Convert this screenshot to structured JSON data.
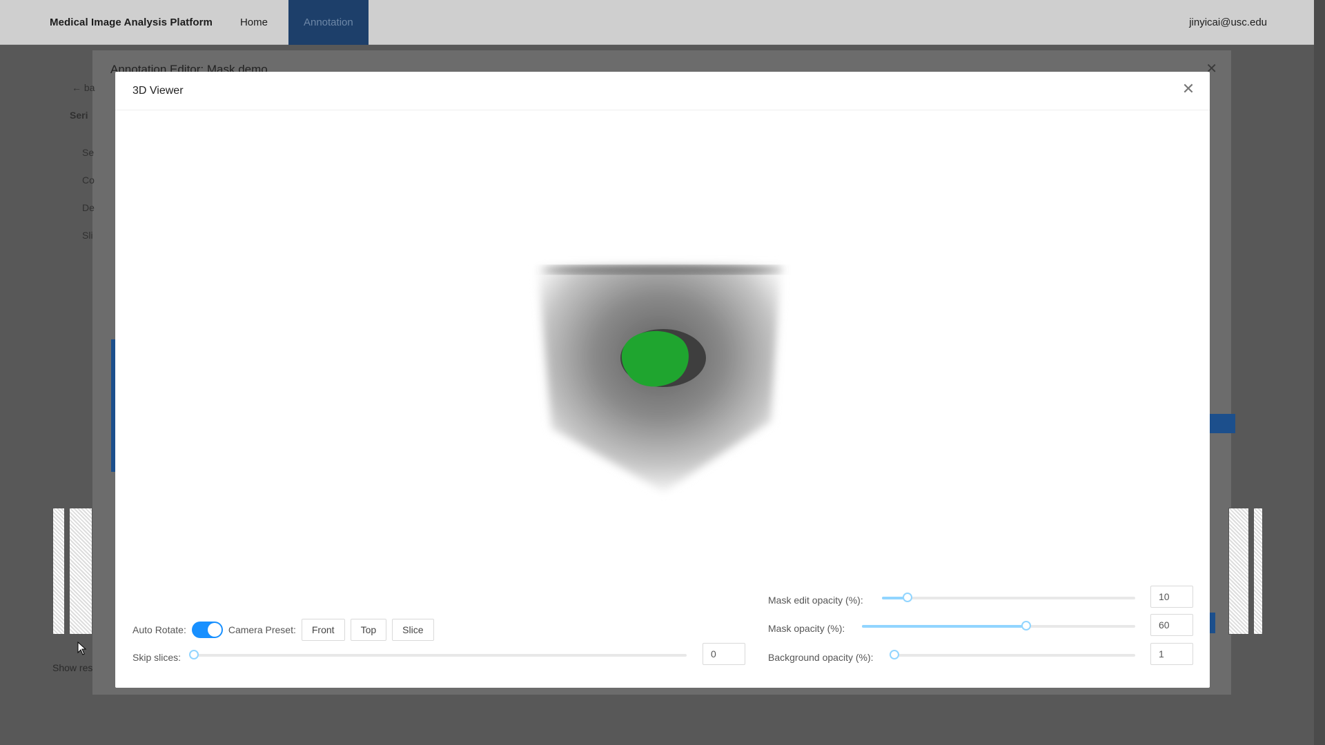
{
  "app": {
    "brand": "Medical Image Analysis Platform",
    "nav": [
      "Home",
      "Annotation"
    ],
    "user": "jinyicai@usc.edu"
  },
  "editor": {
    "title": "Annotation Editor: Mask demo",
    "side_labels": [
      "ba",
      "Seri",
      "Se",
      "Co",
      "De",
      "Sli"
    ],
    "show_results": "Show res"
  },
  "viewer": {
    "title": "3D Viewer",
    "auto_rotate_label": "Auto Rotate:",
    "auto_rotate_on": true,
    "camera_preset_label": "Camera Preset:",
    "camera_presets": [
      "Front",
      "Top",
      "Slice"
    ],
    "skip_slices_label": "Skip slices:",
    "skip_slices_value": "0",
    "skip_slices_fraction": 0,
    "mask_edit_opacity_label": "Mask edit opacity (%):",
    "mask_edit_opacity_value": "10",
    "mask_edit_opacity_fraction": 0.1,
    "mask_opacity_label": "Mask opacity (%):",
    "mask_opacity_value": "60",
    "mask_opacity_fraction": 0.6,
    "background_opacity_label": "Background opacity (%):",
    "background_opacity_value": "1",
    "background_opacity_fraction": 0.01
  },
  "colors": {
    "accent": "#1890ff",
    "mask": "#1fa52f",
    "nav_active": "#1d3f6a"
  }
}
